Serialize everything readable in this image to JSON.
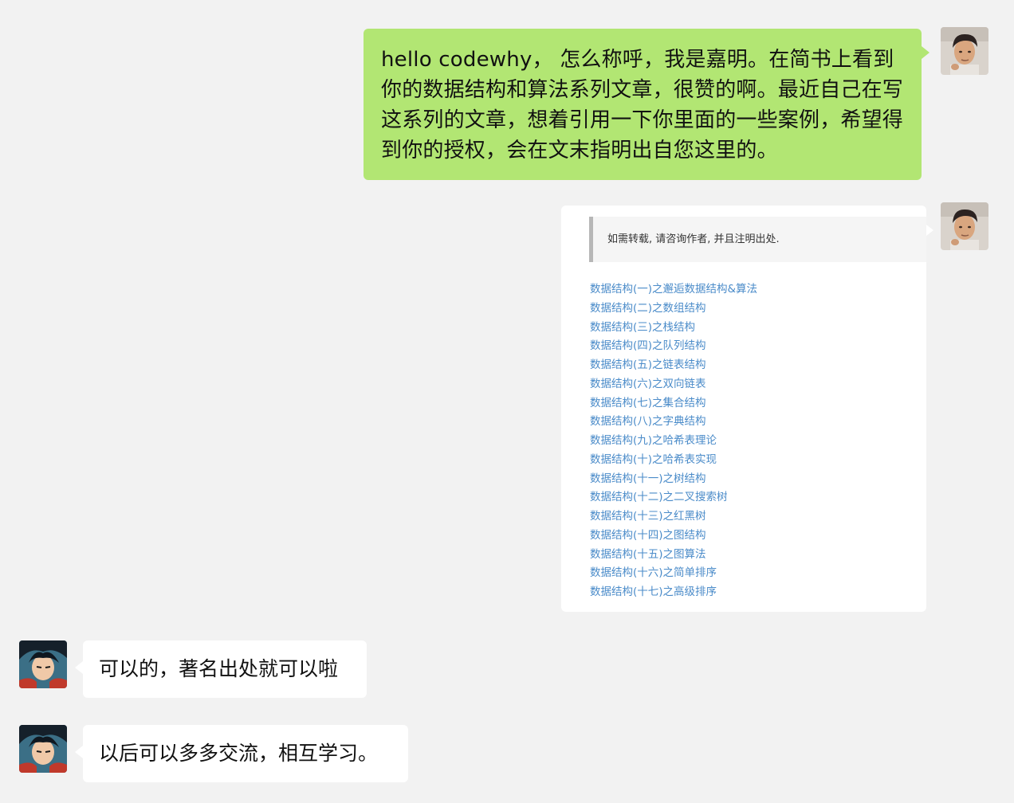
{
  "messages": {
    "m1": {
      "sender_avatar": "man-photo-avatar",
      "text": "hello codewhy， 怎么称呼，我是嘉明。在简书上看到你的数据结构和算法系列文章，很赞的啊。最近自己在写这系列的文章，想着引用一下你里面的一些案例，希望得到你的授权，会在文末指明出自您这里的。"
    },
    "m2": {
      "sender_avatar": "man-photo-avatar",
      "quote": "如需转载, 请咨询作者, 并且注明出处.",
      "links": [
        "数据结构(一)之邂逅数据结构&算法",
        "数据结构(二)之数组结构",
        "数据结构(三)之栈结构",
        "数据结构(四)之队列结构",
        "数据结构(五)之链表结构",
        "数据结构(六)之双向链表",
        "数据结构(七)之集合结构",
        "数据结构(八)之字典结构",
        "数据结构(九)之哈希表理论",
        "数据结构(十)之哈希表实现",
        "数据结构(十一)之树结构",
        "数据结构(十二)之二叉搜索树",
        "数据结构(十三)之红黑树",
        "数据结构(十四)之图结构",
        "数据结构(十五)之图算法",
        "数据结构(十六)之简单排序",
        "数据结构(十七)之高级排序"
      ]
    },
    "m3": {
      "sender_avatar": "anime-character-avatar",
      "text": "可以的，著名出处就可以啦"
    },
    "m4": {
      "sender_avatar": "anime-character-avatar",
      "text": "以后可以多多交流，相互学习。"
    }
  },
  "colors": {
    "background": "#f2f2f2",
    "sent_bubble": "#b2e673",
    "received_bubble": "#ffffff",
    "link": "#4a8bc9",
    "quote_bar": "#b7b7b7"
  }
}
